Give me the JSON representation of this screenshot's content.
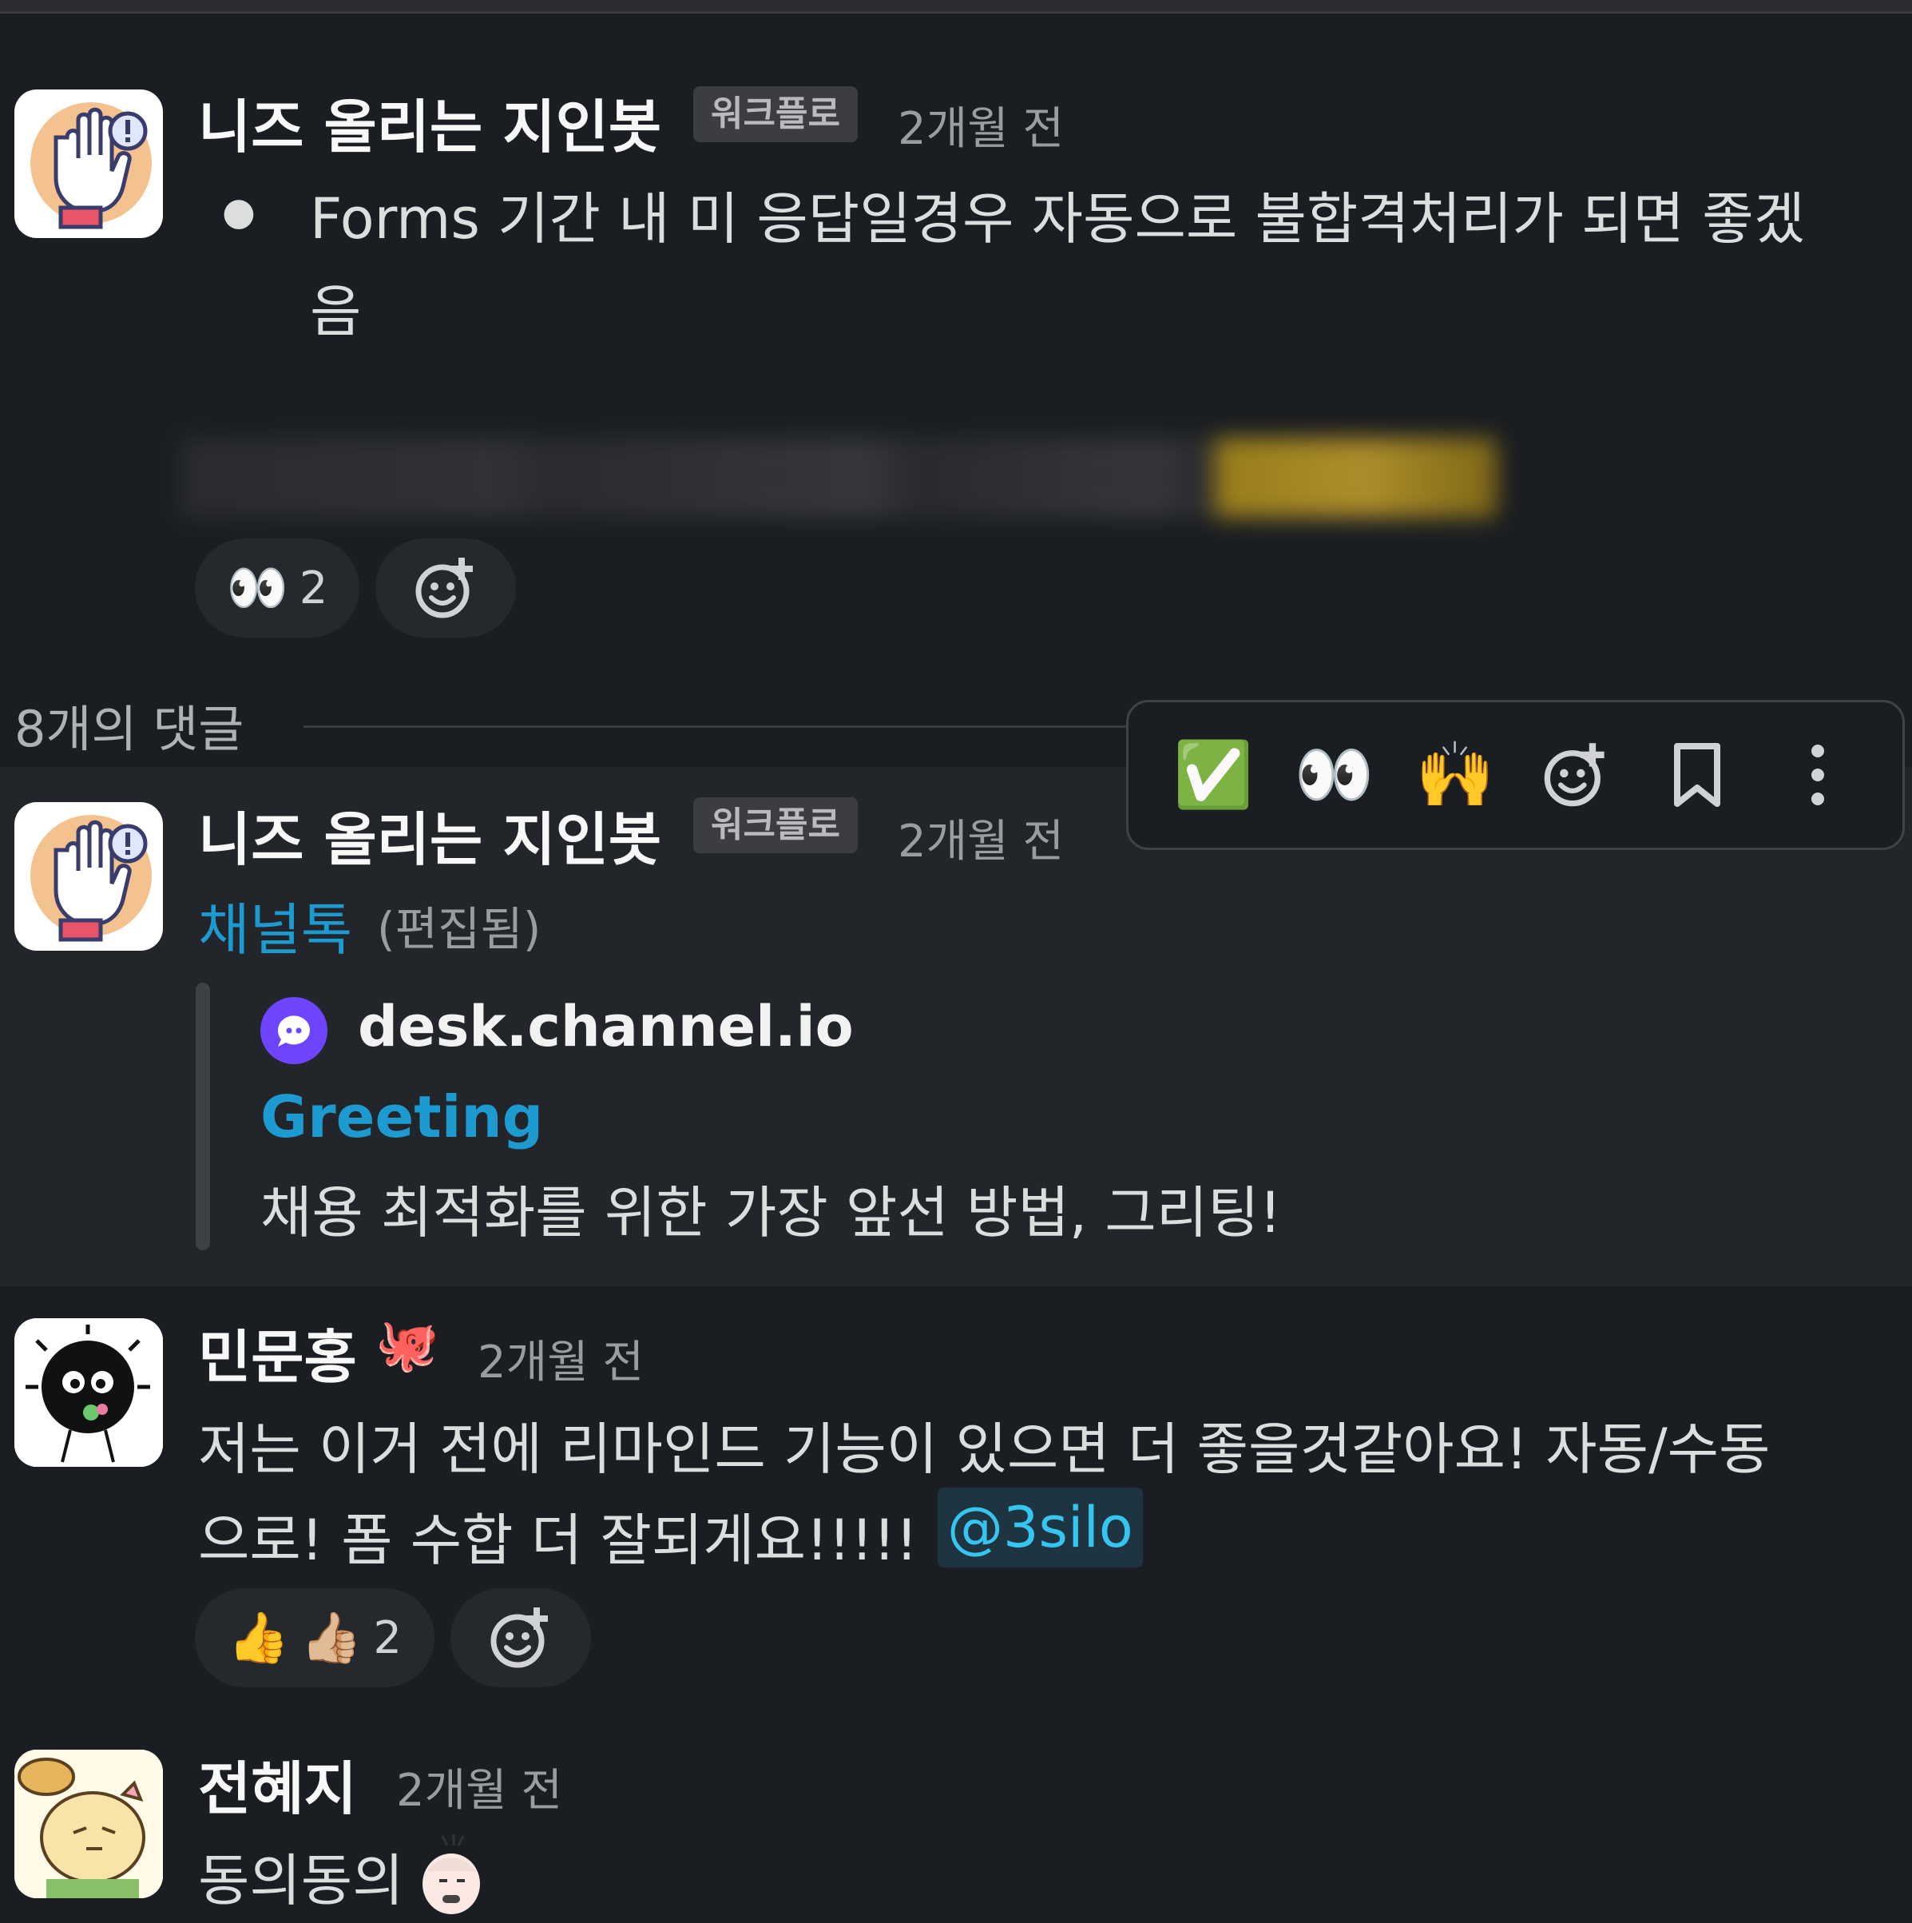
{
  "message1": {
    "author": "니즈 올리는 지인봇",
    "tag": "워크플로",
    "time": "2개월 전",
    "bullet": "●",
    "line1": "Forms 기간 내 미 응답일경우 자동으로 불합격처리가 되면 좋겠",
    "line2": "음",
    "reaction_emoji": "👀",
    "reaction_count": "2",
    "add_reaction_icon": "add-reaction-icon"
  },
  "thread": {
    "count_label": "8개의 댓글"
  },
  "toolbar": {
    "check_emoji": "✅",
    "eyes_emoji": "👀",
    "raised_hands_emoji": "🙌",
    "icons": [
      "add-reaction-icon",
      "bookmark-icon",
      "more-vertical-icon"
    ]
  },
  "message2": {
    "author": "니즈 올리는 지인봇",
    "tag": "워크플로",
    "time": "2개월 전",
    "link_text": "채널톡",
    "edited": "(편집됨)",
    "attachment": {
      "site": "desk.channel.io",
      "title": "Greeting",
      "description": "채용 최적화를 위한 가장 앞선 방법, 그리팅!"
    }
  },
  "message3": {
    "author": "민문홍",
    "status_emoji": "🐙",
    "time": "2개월 전",
    "line1": "저는 이거 전에 리마인드 기능이 있으면 더 좋을것같아요! 자동/수동",
    "line2": "으로! 폼 수합 더 잘되게요!!!!!",
    "mention": "@3silo",
    "reaction_emoji1": "👍",
    "reaction_emoji2": "👍🏼",
    "reaction_count": "2"
  },
  "message4": {
    "author": "전혜지",
    "time": "2개월 전",
    "text": "동의동의"
  },
  "colors": {
    "background": "#1a1d21",
    "hover_background": "#222529",
    "link": "#1d9bd1",
    "mention": "#36c5f0",
    "channel_purple": "#6e44ff"
  }
}
